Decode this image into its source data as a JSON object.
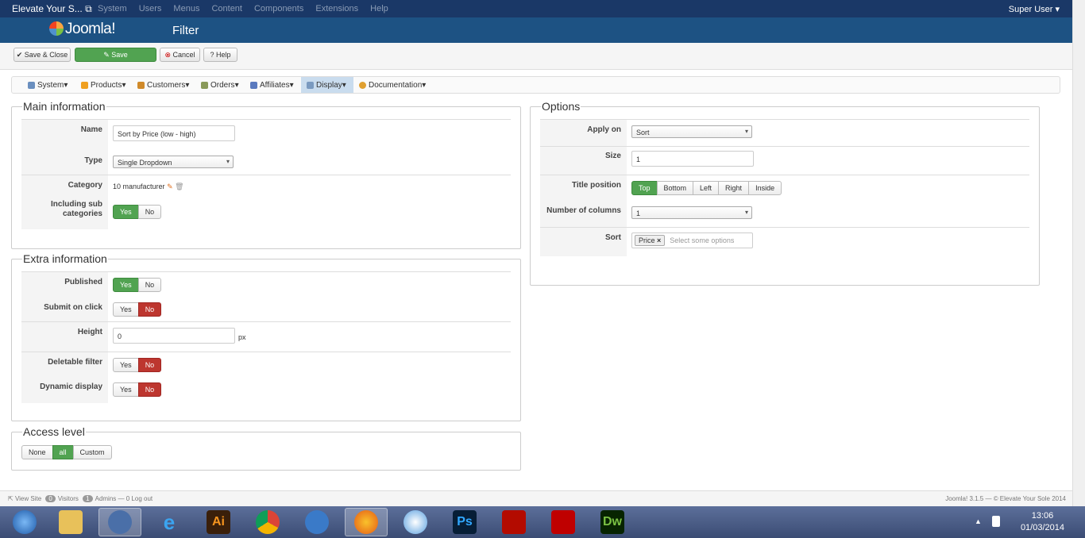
{
  "topbar": {
    "site": "Elevate Your S...",
    "menu": [
      "System",
      "Users",
      "Menus",
      "Content",
      "Components",
      "Extensions",
      "Help"
    ],
    "user": "Super User"
  },
  "header": {
    "brand": "Joomla!",
    "title": "Filter"
  },
  "toolbar": {
    "save_close": "Save & Close",
    "save": "Save",
    "cancel": "Cancel",
    "help": "Help"
  },
  "submenu": [
    "System",
    "Products",
    "Customers",
    "Orders",
    "Affiliates",
    "Display",
    "Documentation"
  ],
  "main": {
    "legend": "Main information",
    "name_label": "Name",
    "name_value": "Sort by Price (low - high)",
    "type_label": "Type",
    "type_value": "Single Dropdown",
    "category_label": "Category",
    "category_value": "10 manufacturer",
    "subcat_label": "Including sub categories",
    "yes": "Yes",
    "no": "No"
  },
  "extra": {
    "legend": "Extra information",
    "published": "Published",
    "submit": "Submit on click",
    "height": "Height",
    "height_value": "0",
    "px": "px",
    "deletable": "Deletable filter",
    "dynamic": "Dynamic display"
  },
  "access": {
    "legend": "Access level",
    "none": "None",
    "all": "all",
    "custom": "Custom"
  },
  "options": {
    "legend": "Options",
    "apply_label": "Apply on",
    "apply_value": "Sort",
    "size_label": "Size",
    "size_value": "1",
    "title_pos_label": "Title position",
    "positions": [
      "Top",
      "Bottom",
      "Left",
      "Right",
      "Inside"
    ],
    "columns_label": "Number of columns",
    "columns_value": "1",
    "sort_label": "Sort",
    "sort_tag": "Price",
    "sort_placeholder": "Select some options"
  },
  "status": {
    "view_site": "View Site",
    "visitors_count": "0",
    "visitors": "Visitors",
    "admins_count": "1",
    "admins": "Admins",
    "logout": "0 Log out",
    "version": "Joomla! 3.1.5 — © Elevate Your Sole 2014"
  },
  "taskbar": {
    "time": "13:06",
    "date": "01/03/2014",
    "apps": [
      "Ai",
      "Ps",
      "Dw"
    ]
  }
}
